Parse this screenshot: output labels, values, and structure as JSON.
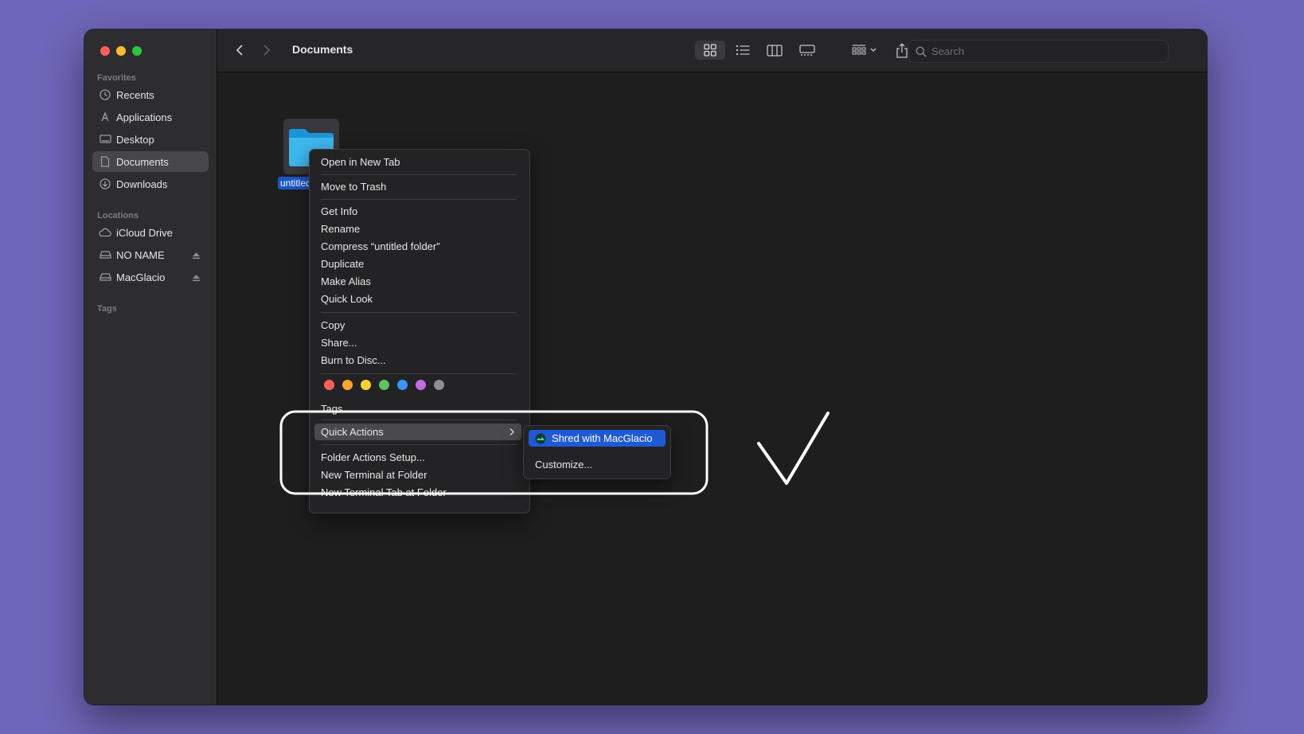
{
  "window": {
    "title": "Documents"
  },
  "colors": {
    "close": "#ff5f57",
    "minimize": "#febc2e",
    "zoom": "#28c840",
    "accent": "#1f5ad6",
    "desktop": "#6e66b8"
  },
  "sidebar": {
    "favorites_label": "Favorites",
    "favorites": [
      {
        "label": "Recents",
        "icon": "clock-icon"
      },
      {
        "label": "Applications",
        "icon": "apps-icon"
      },
      {
        "label": "Desktop",
        "icon": "desktop-icon"
      },
      {
        "label": "Documents",
        "icon": "doc-icon",
        "selected": true
      },
      {
        "label": "Downloads",
        "icon": "download-icon"
      }
    ],
    "locations_label": "Locations",
    "locations": [
      {
        "label": "iCloud Drive",
        "icon": "cloud-icon"
      },
      {
        "label": "NO NAME",
        "icon": "drive-icon",
        "ejectable": true
      },
      {
        "label": "MacGlacio",
        "icon": "drive-icon",
        "ejectable": true
      }
    ],
    "tags_label": "Tags"
  },
  "search": {
    "placeholder": "Search"
  },
  "folder": {
    "label": "untitled folder"
  },
  "context_menu": {
    "items": [
      "Open in New Tab",
      "Move to Trash",
      "Get Info",
      "Rename",
      "Compress “untitled folder”",
      "Duplicate",
      "Make Alias",
      "Quick Look",
      "Copy",
      "Share...",
      "Burn to Disc...",
      "Tags...",
      "Quick Actions",
      "Folder Actions Setup...",
      "New Terminal at Folder",
      "New Terminal Tab at Folder"
    ],
    "tag_colors": [
      "#fe5f57",
      "#f8a532",
      "#f6d033",
      "#5ac35d",
      "#3a95f5",
      "#bf6ee3",
      "#8e8e93"
    ]
  },
  "submenu": {
    "items": [
      "Shred with MacGlacio",
      "Customize..."
    ]
  }
}
